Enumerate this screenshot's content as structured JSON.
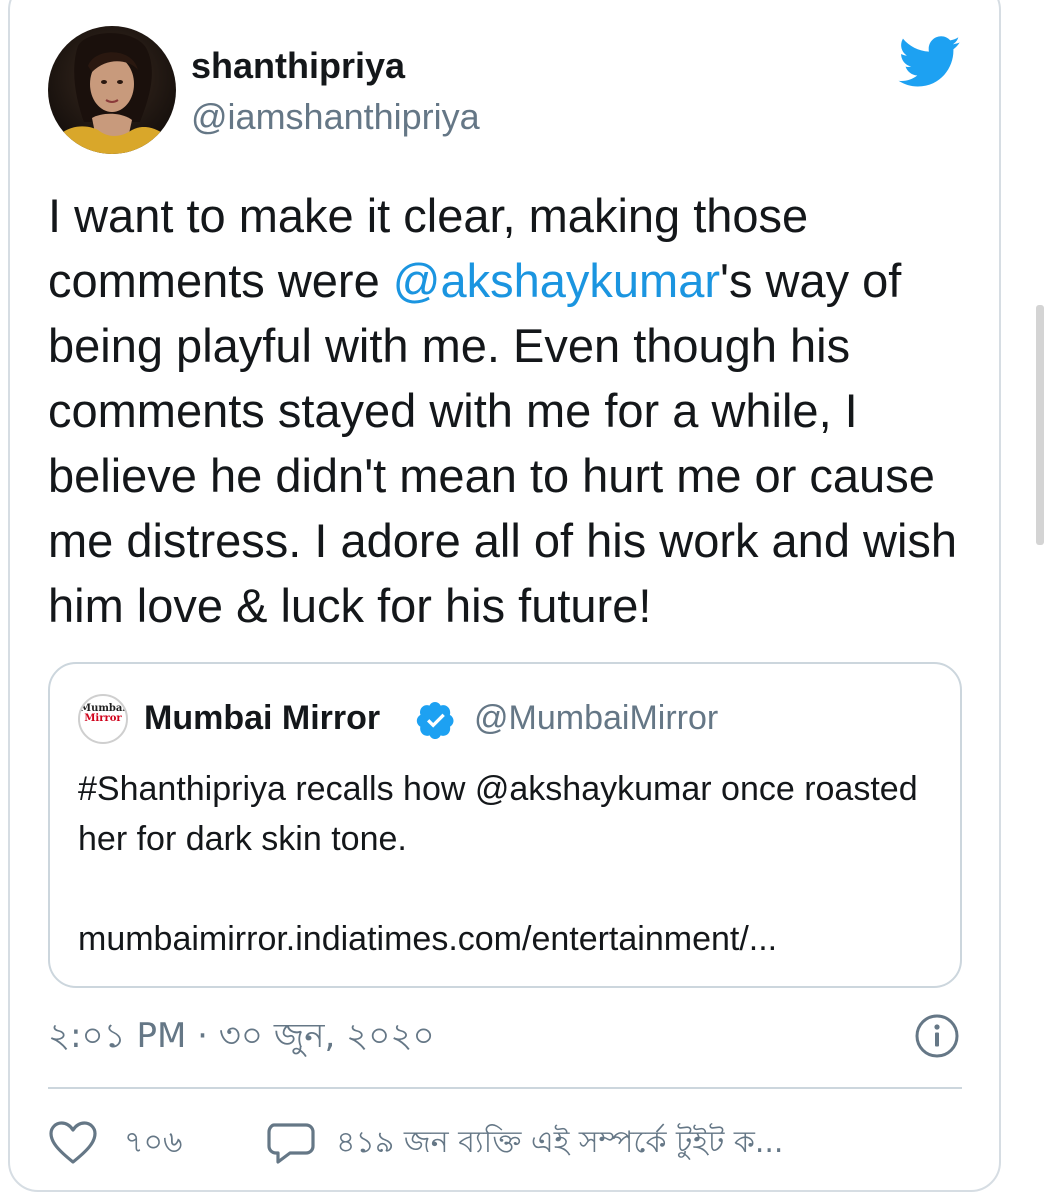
{
  "colors": {
    "text": "#14171a",
    "muted": "#657786",
    "link": "#1b95e0",
    "border": "#ccd6dd",
    "twitter_blue": "#1da1f2"
  },
  "tweet": {
    "author": {
      "display_name": "shanthipriya",
      "handle": "@iamshanthipriya",
      "avatar_icon": "profile-photo"
    },
    "platform_icon": "twitter-bird-icon",
    "text_before_mention": "I want to make it clear, making those comments were ",
    "mention": "@akshaykumar",
    "text_after_mention": "'s way of being playful with me. Even though his comments stayed with me for a while, I believe he didn't mean to hurt me or cause me distress. I adore all of his work and wish him love & luck for his future!",
    "quoted_tweet": {
      "logo_line1": "Mumbai",
      "logo_line2": "Mirror",
      "display_name": "Mumbai Mirror",
      "verified_icon": "verified-badge-icon",
      "handle": "@MumbaiMirror",
      "text": "#Shanthipriya recalls how @akshaykumar once roasted her for dark skin tone.",
      "link": "mumbaimirror.indiatimes.com/entertainment/..."
    },
    "timestamp": "২:০১ PM · ৩০ জুন, ২০২০",
    "info_icon": "info-icon",
    "actions": {
      "like_icon": "heart-icon",
      "like_count": "৭০৬",
      "reply_icon": "speech-bubble-icon",
      "reply_label": "৪১৯ জন ব্যক্তি এই সম্পর্কে টুইট ক..."
    }
  }
}
